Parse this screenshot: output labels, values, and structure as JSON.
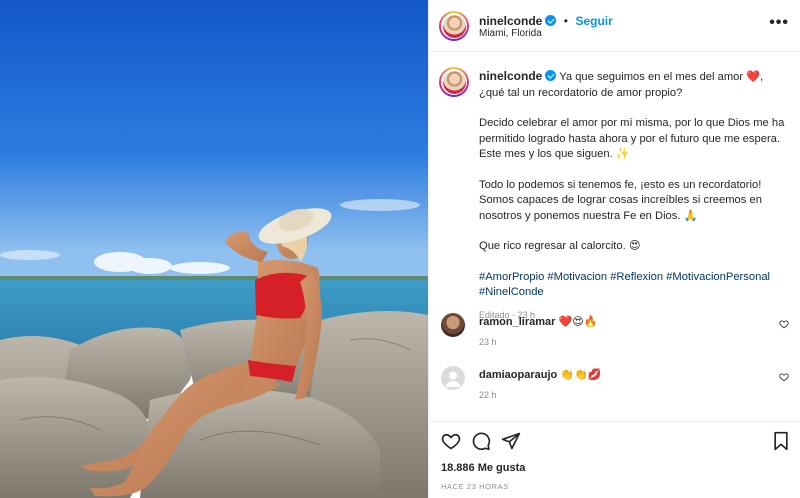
{
  "post": {
    "username": "ninelconde",
    "separator": "•",
    "follow_label": "Seguir",
    "location": "Miami, Florida",
    "more_label": "•••"
  },
  "caption": {
    "username": "ninelconde",
    "para1": "Ya que seguimos en el mes del amor ❤️, ¿qué tal un recordatorio de amor propio?",
    "para2": "Decido celebrar el amor por mí misma, por lo que Dios me ha permitido logrado hasta ahora y por el futuro que me espera. Este mes y los que siguen. ✨",
    "para3": "Todo lo podemos si tenemos fe, ¡esto es un recordatorio! Somos capaces de lograr cosas increíbles si creemos en nosotros y ponemos nuestra Fe en Dios. 🙏",
    "para4": "Que rico regresar al calorcito. 😍",
    "hashtags": "#AmorPropio #Motivacion #Reflexion #MotivacionPersonal #NinelConde",
    "meta": "Editado · 23 h"
  },
  "comments": [
    {
      "username": "ramon_liramar",
      "text": "❤️😍🔥",
      "time": "23 h"
    },
    {
      "username": "damiaoparaujo",
      "text": "👏👏💋",
      "time": "22 h"
    }
  ],
  "stats": {
    "likes": "18.886 Me gusta",
    "posted": "HACE 23 HORAS"
  },
  "icons": {
    "like": "heart-icon",
    "comment": "comment-icon",
    "share": "share-icon",
    "save": "bookmark-icon",
    "more": "more-icon",
    "verified": "verified-badge-icon"
  },
  "colors": {
    "link": "#0095f6",
    "hashtag": "#00376b",
    "muted": "#8e8e8e",
    "text": "#262626"
  }
}
